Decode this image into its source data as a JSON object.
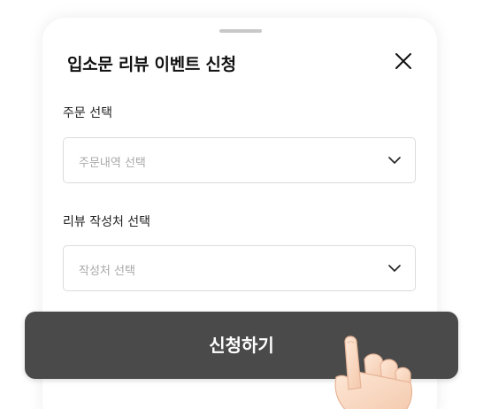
{
  "sheet": {
    "title": "입소문 리뷰 이벤트 신청"
  },
  "fields": [
    {
      "label": "주문 선택",
      "placeholder": "주문내역 선택"
    },
    {
      "label": "리뷰 작성처 선택",
      "placeholder": "작성처 선택"
    }
  ],
  "submit": {
    "label": "신청하기"
  },
  "icons": {
    "close": "close-icon",
    "chevron": "chevron-down-icon",
    "pointer": "pointing-hand-icon"
  },
  "colors": {
    "submit_bg": "#4a4a4a",
    "placeholder": "#a8a8a8",
    "border": "#dcdcdc",
    "title": "#111111"
  }
}
